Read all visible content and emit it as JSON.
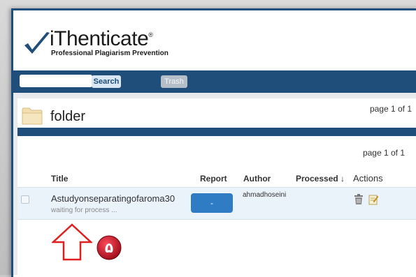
{
  "logo": {
    "name": "iThenticate",
    "registered": "®",
    "tagline": "Professional Plagiarism Prevention"
  },
  "navbar": {
    "search_placeholder": "",
    "search_label": "Search",
    "trash_label": "Trash"
  },
  "folder": {
    "name": "folder",
    "page_top": "page 1 of 1",
    "page_mid": "page 1 of 1"
  },
  "table": {
    "headers": {
      "title": "Title",
      "report": "Report",
      "author": "Author",
      "processed": "Processed ↓",
      "actions": "Actions"
    },
    "rows": [
      {
        "title": "Astudyonseparatingofaroma30",
        "status": "waiting for process ...",
        "report": "-",
        "author": "ahmadhoseini"
      }
    ]
  },
  "annotation": {
    "badge_number": "۵"
  },
  "colors": {
    "navy": "#1f4e7a",
    "report_blue": "#2f7cc4",
    "row_bg": "#eaf2fa",
    "arrow_red": "#e02020",
    "badge_red": "#c8102e"
  },
  "icons": [
    "checkmark-logo-icon",
    "folder-icon",
    "trash-icon",
    "edit-icon",
    "up-arrow-icon"
  ]
}
